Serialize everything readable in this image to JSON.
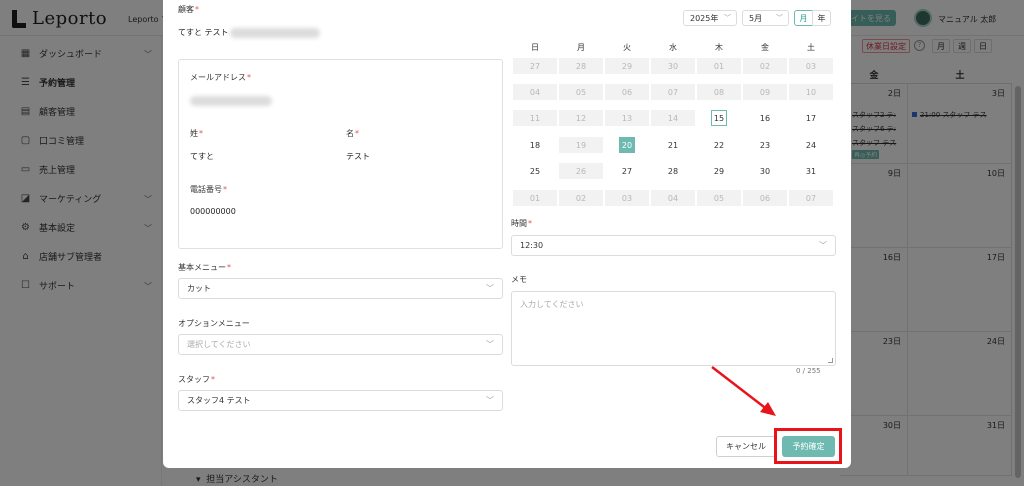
{
  "app": {
    "logo_text": "Leporto",
    "store_name": "Leporto マ",
    "site_button": "イトを見る",
    "user_name": "マニュアル 太郎"
  },
  "sidebar": {
    "items": [
      {
        "label": "ダッシュボード",
        "icon": "dashboard-icon",
        "has_chevron": true
      },
      {
        "label": "予約管理",
        "icon": "list-icon",
        "has_chevron": false,
        "active": true
      },
      {
        "label": "顧客管理",
        "icon": "customer-card-icon",
        "has_chevron": false
      },
      {
        "label": "口コミ管理",
        "icon": "comment-icon",
        "has_chevron": false
      },
      {
        "label": "売上管理",
        "icon": "sales-icon",
        "has_chevron": false
      },
      {
        "label": "マーケティング",
        "icon": "marketing-icon",
        "has_chevron": true
      },
      {
        "label": "基本設定",
        "icon": "gear-icon",
        "has_chevron": true
      },
      {
        "label": "店舗サブ管理者",
        "icon": "admin-user-icon",
        "has_chevron": false
      },
      {
        "label": "サポート",
        "icon": "support-icon",
        "has_chevron": true
      }
    ]
  },
  "calendar_bg": {
    "holiday_button": "休業日設定",
    "view_month": "月",
    "view_week": "週",
    "view_day": "日",
    "headers": [
      "金",
      "土"
    ],
    "dates": [
      "2日",
      "3日",
      "9日",
      "10日",
      "16日",
      "17日",
      "23日",
      "24日",
      "30日",
      "31日"
    ],
    "events_fri": [
      "スタッフ2 テ:",
      "スタッフ6 テ:",
      "スタッフ テス"
    ],
    "event_sat": {
      "time": "21:00",
      "label": "スタッフ テス"
    },
    "event_tag": "再◎予約",
    "assistant_label": "担当アシスタント"
  },
  "modal": {
    "customer_label": "顧客",
    "customer_value": "てすと テスト",
    "email_label": "メールアドレス",
    "last_name_label": "姓",
    "last_name_value": "てすと",
    "first_name_label": "名",
    "first_name_value": "テスト",
    "phone_label": "電話番号",
    "phone_value": "000000000",
    "base_menu_label": "基本メニュー",
    "base_menu_value": "カット",
    "option_menu_label": "オプションメニュー",
    "option_menu_placeholder": "選択してください",
    "staff_label": "スタッフ",
    "staff_value": "スタッフ4 テスト",
    "year_select": "2025年",
    "month_select": "5月",
    "toggle_month": "月",
    "toggle_year": "年",
    "weekdays": [
      "日",
      "月",
      "火",
      "水",
      "木",
      "金",
      "土"
    ],
    "weeks": [
      [
        "27",
        "28",
        "29",
        "30",
        "01",
        "02",
        "03"
      ],
      [
        "04",
        "05",
        "06",
        "07",
        "08",
        "09",
        "10"
      ],
      [
        "11",
        "12",
        "13",
        "14",
        "15",
        "16",
        "17"
      ],
      [
        "18",
        "19",
        "20",
        "21",
        "22",
        "23",
        "24"
      ],
      [
        "25",
        "26",
        "27",
        "28",
        "29",
        "30",
        "31"
      ],
      [
        "01",
        "02",
        "03",
        "04",
        "05",
        "06",
        "07"
      ]
    ],
    "today": "15",
    "selected": "20",
    "time_label": "時間",
    "time_value": "12:30",
    "memo_label": "メモ",
    "memo_placeholder": "入力してください",
    "memo_counter": "0 / 255",
    "cancel_button": "キャンセル",
    "confirm_button": "予約確定"
  },
  "colors": {
    "accent": "#6fbab0",
    "highlight": "#e8141a",
    "required": "#e05555"
  }
}
